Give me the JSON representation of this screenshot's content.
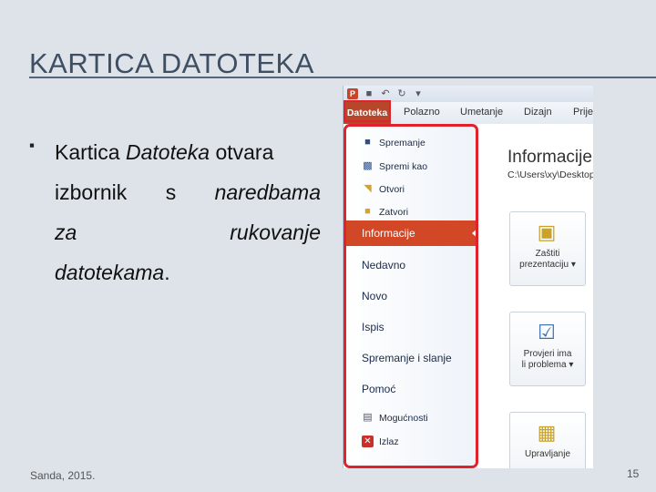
{
  "slide": {
    "title": "KARTICA DATOTEKA",
    "bullet": {
      "lead": "Kartica",
      "emph": "Datoteka",
      "verb": "otvara",
      "w1": "izbornik",
      "w2": "s",
      "w3": "naredbama",
      "w4": "za",
      "w5": "rukovanje",
      "w6": "datotekama",
      "period": "."
    },
    "footer_author": "Sanda, 2015.",
    "page_number": "15"
  },
  "screenshot": {
    "qat_icons": [
      "powerpoint-logo",
      "save-icon",
      "undo-icon",
      "redo-icon",
      "customize-icon"
    ],
    "tabs": [
      "Datoteka",
      "Polazno",
      "Umetanje",
      "Dizajn",
      "Prije"
    ],
    "backstage_commands": [
      {
        "label": "Spremanje",
        "icon": "save-icon"
      },
      {
        "label": "Spremi kao",
        "icon": "save-as-icon"
      },
      {
        "label": "Otvori",
        "icon": "open-folder-icon"
      },
      {
        "label": "Zatvori",
        "icon": "close-folder-icon"
      }
    ],
    "active_tab": "Informacije",
    "backstage_tabs": [
      "Nedavno",
      "Novo",
      "Ispis",
      "Spremanje i slanje",
      "Pomoć"
    ],
    "bottom_commands": [
      {
        "label": "Mogućnosti",
        "icon": "options-icon"
      },
      {
        "label": "Izlaz",
        "icon": "exit-icon"
      }
    ],
    "info": {
      "title": "Informacije",
      "path": "C:\\Users\\xy\\Desktop",
      "cards": [
        {
          "label1": "Zaštiti",
          "label2": "prezentaciju ▾",
          "icon": "lock-icon"
        },
        {
          "label1": "Provjeri ima",
          "label2": "li problema ▾",
          "icon": "inspect-icon"
        },
        {
          "label1": "Upravljanje",
          "label2": "",
          "icon": "versions-icon"
        }
      ]
    },
    "colors": {
      "file_tab": "#b7472a",
      "active_tab": "#d24726",
      "highlight": "#e0222c"
    }
  }
}
